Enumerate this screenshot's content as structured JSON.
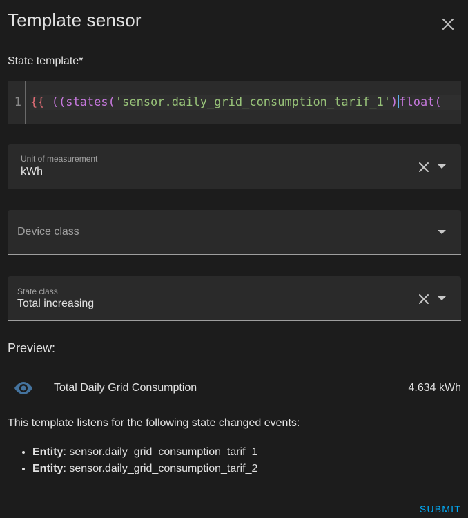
{
  "dialog": {
    "title": "Template sensor",
    "close_icon": "close-icon"
  },
  "state_template": {
    "label": "State template*",
    "line_number": "1",
    "code": {
      "open_brace": "{{",
      "parens": " ((",
      "fn": "states",
      "open_paren": "(",
      "string": "'sensor.daily_grid_consumption_tarif_1'",
      "close_paren": ")",
      "filter": "float("
    }
  },
  "unit_of_measurement": {
    "label": "Unit of measurement",
    "value": "kWh"
  },
  "device_class": {
    "placeholder": "Device class"
  },
  "state_class": {
    "label": "State class",
    "value": "Total increasing"
  },
  "preview": {
    "label": "Preview:",
    "entity_icon": "eye-icon",
    "entity_name": "Total Daily Grid Consumption",
    "entity_state": "4.634 kWh",
    "listens_text": "This template listens for the following state changed events:",
    "listeners": [
      {
        "kind": "Entity",
        "value": ": sensor.daily_grid_consumption_tarif_1"
      },
      {
        "kind": "Entity",
        "value": ": sensor.daily_grid_consumption_tarif_2"
      }
    ]
  },
  "actions": {
    "submit_label": "SUBMIT"
  },
  "colors": {
    "background": "#1c1c1c",
    "field_background": "#2a2a2a",
    "accent": "#03a9f4",
    "icon_blue": "#44739e"
  }
}
